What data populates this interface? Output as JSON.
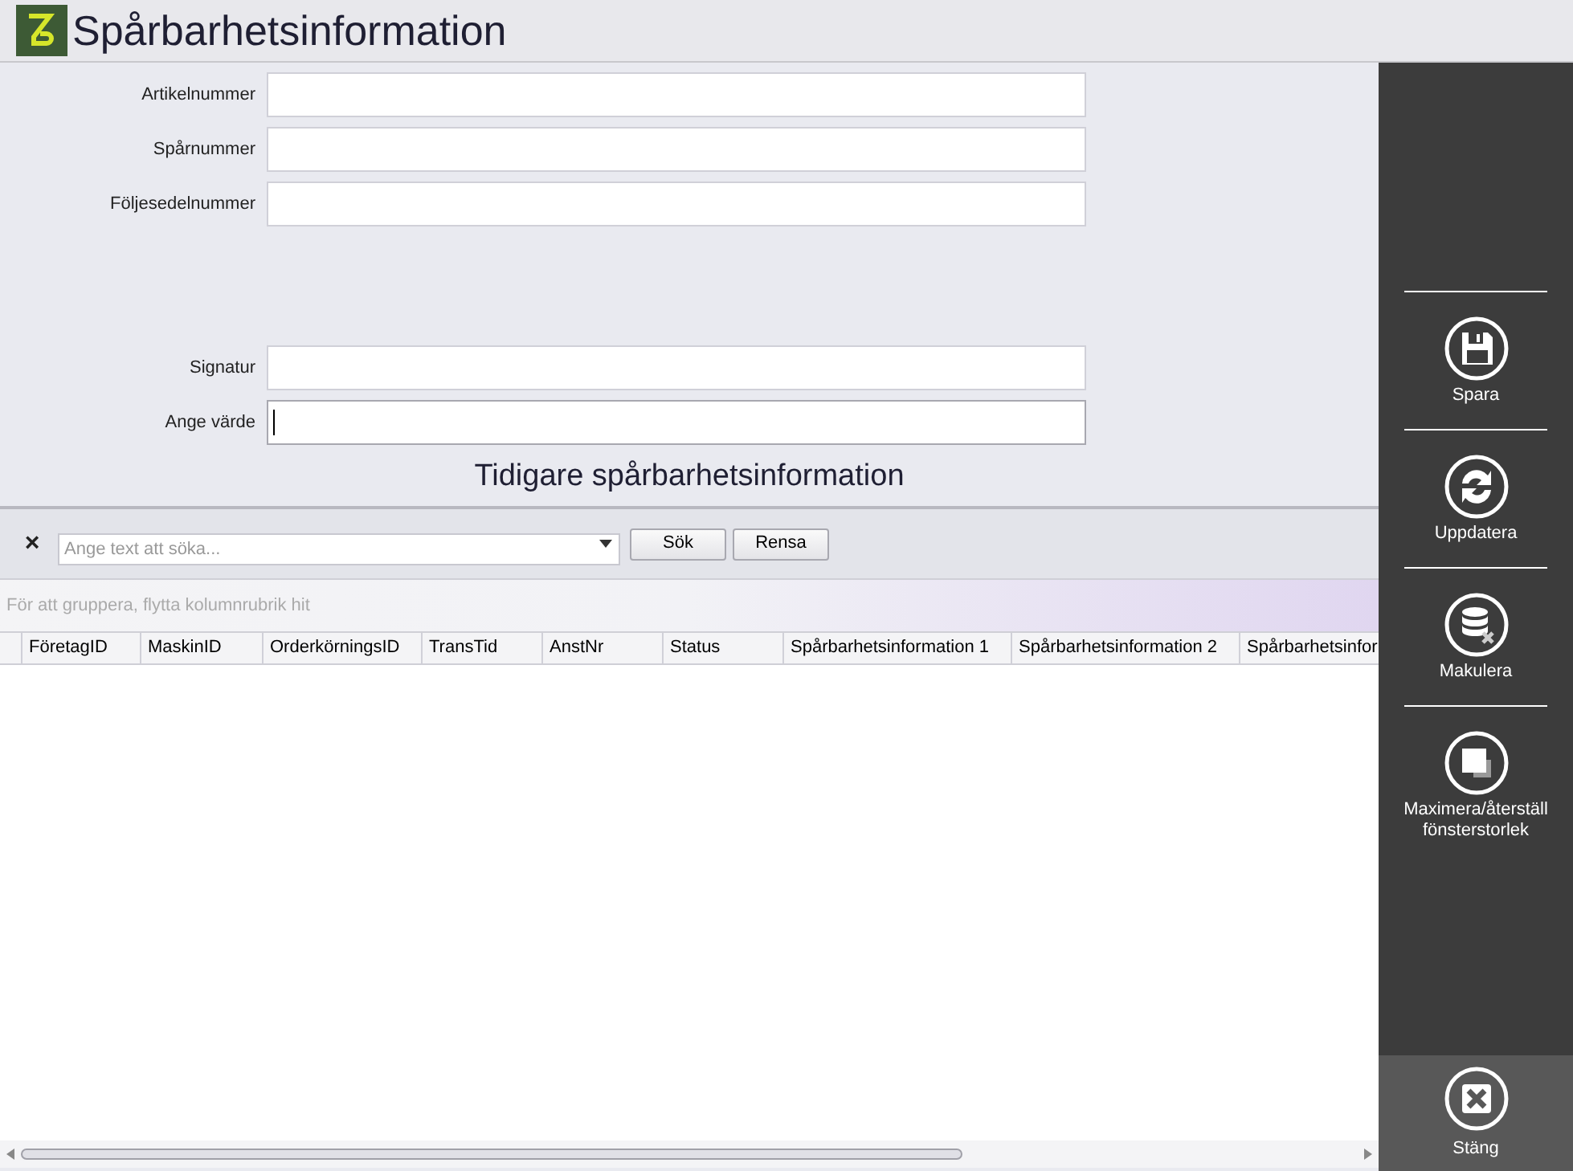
{
  "window": {
    "title": "Spårbarhetsinformation"
  },
  "form": {
    "fields": [
      {
        "label": "Artikelnummer",
        "focused": false
      },
      {
        "label": "Spårnummer",
        "focused": false
      },
      {
        "label": "Följesedelnummer",
        "focused": false
      },
      {
        "label": "Signatur",
        "focused": false
      },
      {
        "label": "Ange värde",
        "focused": true
      }
    ]
  },
  "section_title": "Tidigare spårbarhetsinformation",
  "search": {
    "clear": "×",
    "placeholder": "Ange text att söka...",
    "buttons": [
      "Sök",
      "Rensa"
    ]
  },
  "group_panel": "För att gruppera, flytta kolumnrubrik hit",
  "table": {
    "columns": [
      "FöretagID",
      "MaskinID",
      "OrderkörningsID",
      "TransTid",
      "AnstNr",
      "Status",
      "Spårbarhetsinformation 1",
      "Spårbarhetsinformation 2",
      "Spårbarhetsinfor"
    ]
  },
  "sidebar": {
    "actions": [
      {
        "kind": "save",
        "label": "Spara"
      },
      {
        "kind": "refresh",
        "label": "Uppdatera"
      },
      {
        "kind": "discard",
        "label": "Makulera"
      },
      {
        "kind": "maximize",
        "label": "Maximera/återställ fönsterstorlek"
      }
    ],
    "close": {
      "kind": "close",
      "label": "Stäng"
    }
  }
}
